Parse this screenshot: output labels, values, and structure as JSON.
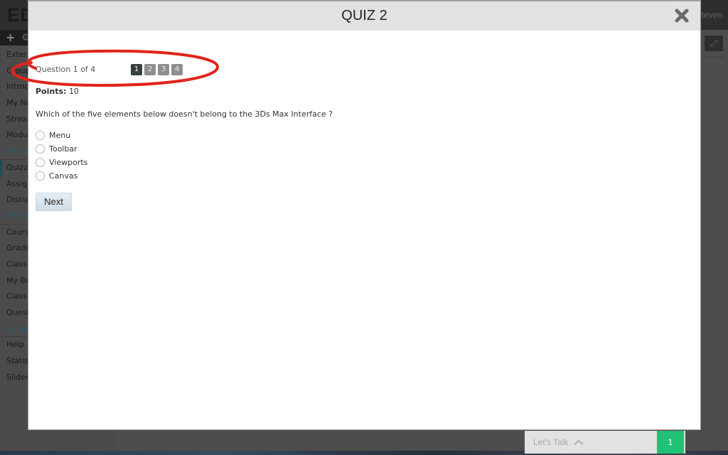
{
  "background_app": {
    "logo": "ED",
    "user_name": "Steven",
    "toolbar_icons": [
      "plus-icon",
      "settings-icon"
    ],
    "expand_icon": "expand-icon",
    "nav_items": [
      {
        "label": "External",
        "type": "item"
      },
      {
        "label": "Groups",
        "type": "item"
      },
      {
        "label": "Introduction",
        "type": "item"
      },
      {
        "label": "My Notes",
        "type": "item"
      },
      {
        "label": "Stream",
        "type": "item"
      },
      {
        "label": "Modules",
        "type": "item"
      },
      {
        "label": "My Activities",
        "type": "section"
      },
      {
        "label": "Quizzes",
        "type": "active"
      },
      {
        "label": "Assignments",
        "type": "item"
      },
      {
        "label": "Discussions",
        "type": "item"
      },
      {
        "label": "My Tools",
        "type": "section"
      },
      {
        "label": "Course",
        "type": "item"
      },
      {
        "label": "Grades",
        "type": "item"
      },
      {
        "label": "Class",
        "type": "item"
      },
      {
        "label": "My Books",
        "type": "item"
      },
      {
        "label": "Class",
        "type": "item"
      },
      {
        "label": "Questions",
        "type": "item"
      },
      {
        "label": "Support",
        "type": "section"
      },
      {
        "label": "Help",
        "type": "item"
      },
      {
        "label": "Statistics",
        "type": "item"
      },
      {
        "label": "Sliders",
        "type": "item"
      }
    ]
  },
  "modal": {
    "title": "QUIZ 2",
    "close_icon": "close-icon",
    "question_counter": "Question 1 of 4",
    "pages": [
      "1",
      "2",
      "3",
      "4"
    ],
    "current_page": "1",
    "points_label": "Points:",
    "points_value": "10",
    "question_text": "Which of the five elements below doesn't belong to the 3Ds Max Interface ?",
    "options": [
      "Menu",
      "Toolbar",
      "Viewports",
      "Canvas"
    ],
    "selected_option": null,
    "next_label": "Next"
  },
  "annotation": {
    "shape": "ellipse",
    "color": "#e0241b",
    "highlights": "question-navigation"
  },
  "chat_widget": {
    "label": "Let's Talk",
    "chevron_icon": "chevron-up-icon",
    "count": "1",
    "count_color": "#22c276"
  }
}
